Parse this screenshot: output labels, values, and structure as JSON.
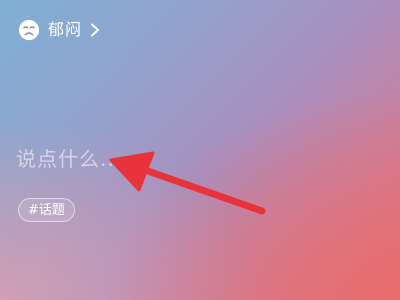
{
  "mood": {
    "label": "郁闷",
    "icon": "sad-face-icon",
    "chevron": "chevron-right-icon"
  },
  "composer": {
    "placeholder": "说点什么..."
  },
  "topic": {
    "label": "#话题"
  },
  "annotation": {
    "icon": "red-arrow-pointer-icon",
    "color": "#e8333a"
  },
  "colors": {
    "gradient_top_left": "#7fb0d6",
    "gradient_bottom_right": "#e27378",
    "text": "#ffffff"
  }
}
